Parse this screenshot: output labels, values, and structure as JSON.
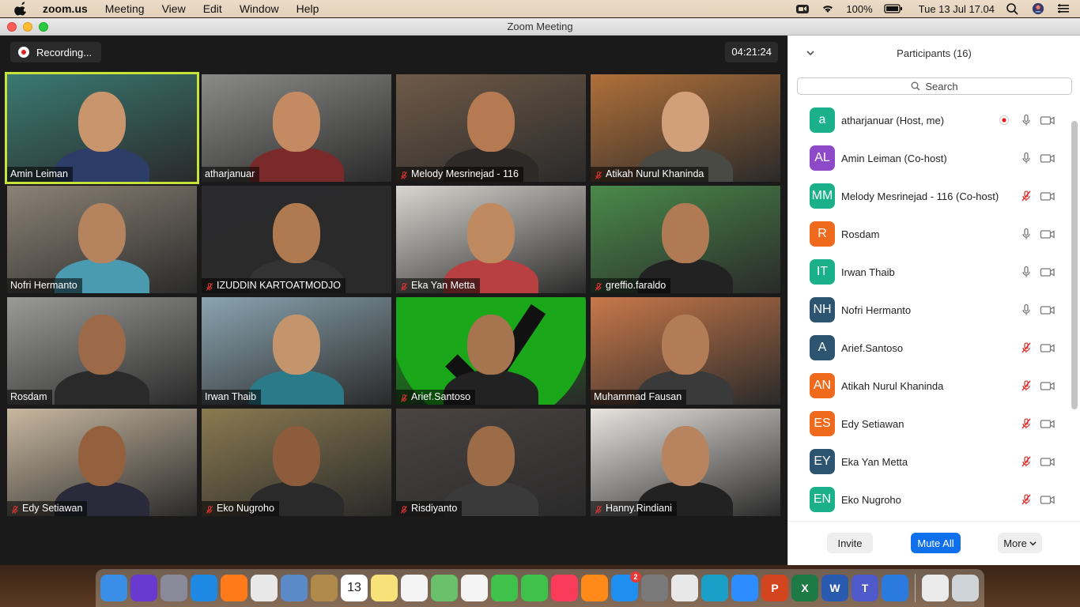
{
  "menubar": {
    "app": "zoom.us",
    "items": [
      "Meeting",
      "View",
      "Edit",
      "Window",
      "Help"
    ],
    "battery": "100%",
    "datetime": "Tue 13 Jul  17.04"
  },
  "window": {
    "title": "Zoom Meeting"
  },
  "meeting": {
    "recording_label": "Recording...",
    "timer": "04:21:24"
  },
  "tiles": [
    {
      "name": "Amin Leiman",
      "muted": false,
      "active": true,
      "bg": "#3a7a72",
      "skin": "#c9956c",
      "shirt": "#2c3e68"
    },
    {
      "name": "atharjanuar",
      "muted": false,
      "active": false,
      "bg": "#8a8a88",
      "skin": "#c48a62",
      "shirt": "#7a2a2a"
    },
    {
      "name": "Melody Mesrinejad - 116",
      "muted": true,
      "active": false,
      "bg": "#6f5a48",
      "skin": "#b57a52",
      "shirt": "#2e2a28"
    },
    {
      "name": "Atikah Nurul Khaninda",
      "muted": true,
      "active": false,
      "bg": "#b0703a",
      "skin": "#d1a07a",
      "shirt": "#4a4a44"
    },
    {
      "name": "Nofri Hermanto",
      "muted": false,
      "active": false,
      "bg": "#8c8276",
      "skin": "#b5835e",
      "shirt": "#4a9ab0"
    },
    {
      "name": "IZUDDIN KARTOATMODJO",
      "muted": true,
      "active": false,
      "bg": "#2a2a2c",
      "skin": "#b07a50",
      "shirt": "#333333"
    },
    {
      "name": "Eka Yan Metta",
      "muted": true,
      "active": false,
      "bg": "#d8d6d0",
      "skin": "#c08a60",
      "shirt": "#b84040"
    },
    {
      "name": "greffio.faraldo",
      "muted": true,
      "active": false,
      "bg": "#4a8a4a",
      "skin": "#b07a55",
      "shirt": "#222222"
    },
    {
      "name": "Rosdam",
      "muted": false,
      "active": false,
      "bg": "#9a9a98",
      "skin": "#9c6a48",
      "shirt": "#2a2a2a"
    },
    {
      "name": "Irwan Thaib",
      "muted": false,
      "active": false,
      "bg": "#8aa4b0",
      "skin": "#c4946c",
      "shirt": "#2a7a8a"
    },
    {
      "name": "Arief.Santoso",
      "muted": true,
      "active": false,
      "bg": "#139a13",
      "skin": "#a6744e",
      "shirt": "#222222"
    },
    {
      "name": "Muhammad Fausan",
      "muted": false,
      "active": false,
      "bg": "#c8784a",
      "skin": "#b27c56",
      "shirt": "#3a3a3a"
    },
    {
      "name": "Edy Setiawan",
      "muted": true,
      "active": false,
      "bg": "#c8b8a0",
      "skin": "#94603e",
      "shirt": "#2a2a3a"
    },
    {
      "name": "Eko Nugroho",
      "muted": true,
      "active": false,
      "bg": "#8a7a50",
      "skin": "#8c5c3c",
      "shirt": "#2a2a2a"
    },
    {
      "name": "Risdiyanto",
      "muted": true,
      "active": false,
      "bg": "#4a4442",
      "skin": "#9c6c48",
      "shirt": "#3a3a3a"
    },
    {
      "name": "Hanny.Rindiani",
      "muted": true,
      "active": false,
      "bg": "#e8e4e0",
      "skin": "#b88460",
      "shirt": "#222222"
    }
  ],
  "participants": {
    "title": "Participants (16)",
    "search_placeholder": "Search",
    "list": [
      {
        "initials": "a",
        "name": "atharjanuar (Host, me)",
        "color": "#1ab08a",
        "mic": "on",
        "recording": true
      },
      {
        "initials": "AL",
        "name": "Amin Leiman (Co-host)",
        "color": "#8d49c7",
        "mic": "on",
        "recording": false
      },
      {
        "initials": "MM",
        "name": "Melody Mesrinejad - 116 (Co-host)",
        "color": "#1ab08a",
        "mic": "muted",
        "recording": false
      },
      {
        "initials": "R",
        "name": "Rosdam",
        "color": "#ef6a1c",
        "mic": "on",
        "recording": false
      },
      {
        "initials": "IT",
        "name": "Irwan Thaib",
        "color": "#1ab08a",
        "mic": "on",
        "recording": false
      },
      {
        "initials": "NH",
        "name": "Nofri Hermanto",
        "color": "#2d5572",
        "mic": "on",
        "recording": false
      },
      {
        "initials": "A",
        "name": "Arief.Santoso",
        "color": "#2d5572",
        "mic": "muted",
        "recording": false
      },
      {
        "initials": "AN",
        "name": "Atikah Nurul Khaninda",
        "color": "#ef6a1c",
        "mic": "muted",
        "recording": false
      },
      {
        "initials": "ES",
        "name": "Edy Setiawan",
        "color": "#ef6a1c",
        "mic": "muted",
        "recording": false
      },
      {
        "initials": "EY",
        "name": "Eka Yan Metta",
        "color": "#2d5572",
        "mic": "muted",
        "recording": false
      },
      {
        "initials": "EN",
        "name": "Eko Nugroho",
        "color": "#1ab08a",
        "mic": "muted",
        "recording": false
      }
    ],
    "buttons": {
      "invite": "Invite",
      "mute_all": "Mute All",
      "more": "More"
    }
  },
  "dock": {
    "apps": [
      {
        "name": "Finder",
        "color": "#3a8ee6"
      },
      {
        "name": "Siri",
        "color": "#6a3ad0"
      },
      {
        "name": "Launchpad",
        "color": "#8a8a9a"
      },
      {
        "name": "Safari",
        "color": "#1e88e5"
      },
      {
        "name": "Firefox",
        "color": "#ff7b1a"
      },
      {
        "name": "Chrome",
        "color": "#e8e8e8"
      },
      {
        "name": "Preview",
        "color": "#5a8ac8"
      },
      {
        "name": "Notebook",
        "color": "#b08a4a"
      },
      {
        "name": "Calendar",
        "color": "#ffffff",
        "text": "13"
      },
      {
        "name": "Notes",
        "color": "#f7e27a"
      },
      {
        "name": "Reminders",
        "color": "#f4f4f4"
      },
      {
        "name": "Maps",
        "color": "#6ac06a"
      },
      {
        "name": "Photos",
        "color": "#f4f4f4"
      },
      {
        "name": "Messages",
        "color": "#3fc24a"
      },
      {
        "name": "FaceTime",
        "color": "#3fc24a"
      },
      {
        "name": "Music",
        "color": "#fa3c5a"
      },
      {
        "name": "Books",
        "color": "#ff8a1a"
      },
      {
        "name": "App Store",
        "color": "#1e8ef0",
        "badge": "2"
      },
      {
        "name": "System Preferences",
        "color": "#7a7a7a"
      },
      {
        "name": "Printer",
        "color": "#e8e8e8"
      },
      {
        "name": "Network",
        "color": "#1aa0c8"
      },
      {
        "name": "Zoom",
        "color": "#2d8cff"
      },
      {
        "name": "PowerPoint",
        "color": "#d2451e",
        "text": "P"
      },
      {
        "name": "Excel",
        "color": "#1d7a44",
        "text": "X"
      },
      {
        "name": "Word",
        "color": "#2a5ab0",
        "text": "W"
      },
      {
        "name": "Teams",
        "color": "#5059c9",
        "text": "T"
      },
      {
        "name": "Blocks",
        "color": "#2a7ae0"
      },
      {
        "name": "Document",
        "color": "#eaeaea"
      },
      {
        "name": "Trash",
        "color": "#cfd4d8"
      }
    ]
  }
}
